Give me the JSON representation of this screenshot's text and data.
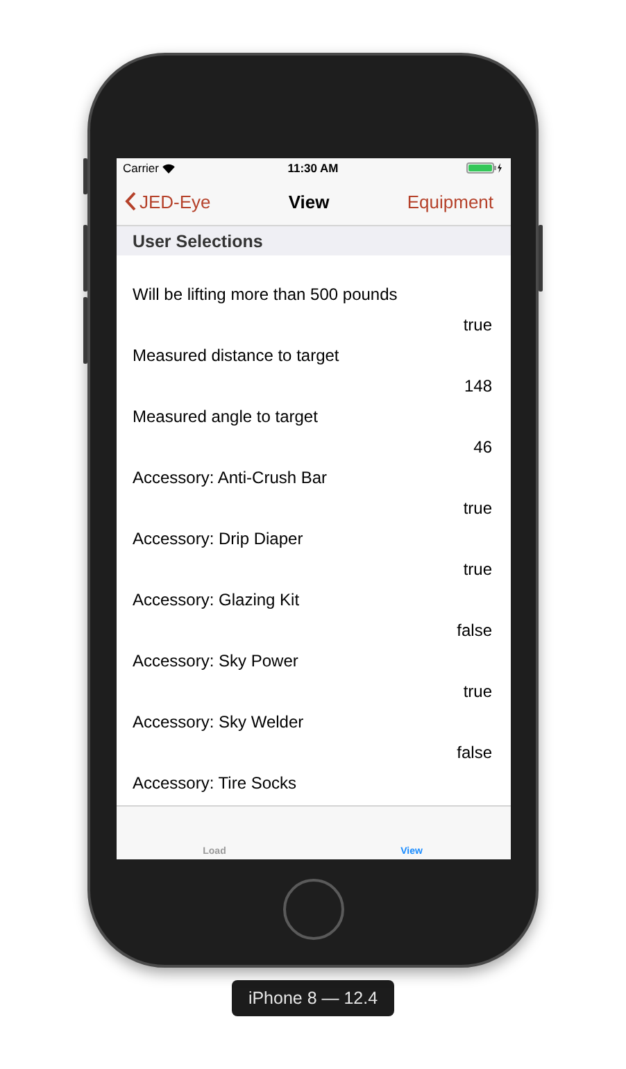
{
  "status_bar": {
    "carrier": "Carrier",
    "time": "11:30 AM"
  },
  "nav": {
    "back": "JED-Eye",
    "title": "View",
    "action": "Equipment"
  },
  "section": {
    "title": "User Selections"
  },
  "items": [
    {
      "label": "Will be lifting more than 500 pounds",
      "value": "true"
    },
    {
      "label": "Measured distance to target",
      "value": "148"
    },
    {
      "label": "Measured angle to target",
      "value": "46"
    },
    {
      "label": "Accessory: Anti-Crush Bar",
      "value": "true"
    },
    {
      "label": "Accessory: Drip Diaper",
      "value": "true"
    },
    {
      "label": "Accessory: Glazing Kit",
      "value": "false"
    },
    {
      "label": "Accessory: Sky Power",
      "value": "true"
    },
    {
      "label": "Accessory: Sky Welder",
      "value": "false"
    },
    {
      "label": "Accessory: Tire Socks"
    }
  ],
  "tabs": [
    {
      "label": "Load",
      "selected": false
    },
    {
      "label": "View",
      "selected": true
    }
  ],
  "device": {
    "label": "iPhone 8 — 12.4"
  }
}
